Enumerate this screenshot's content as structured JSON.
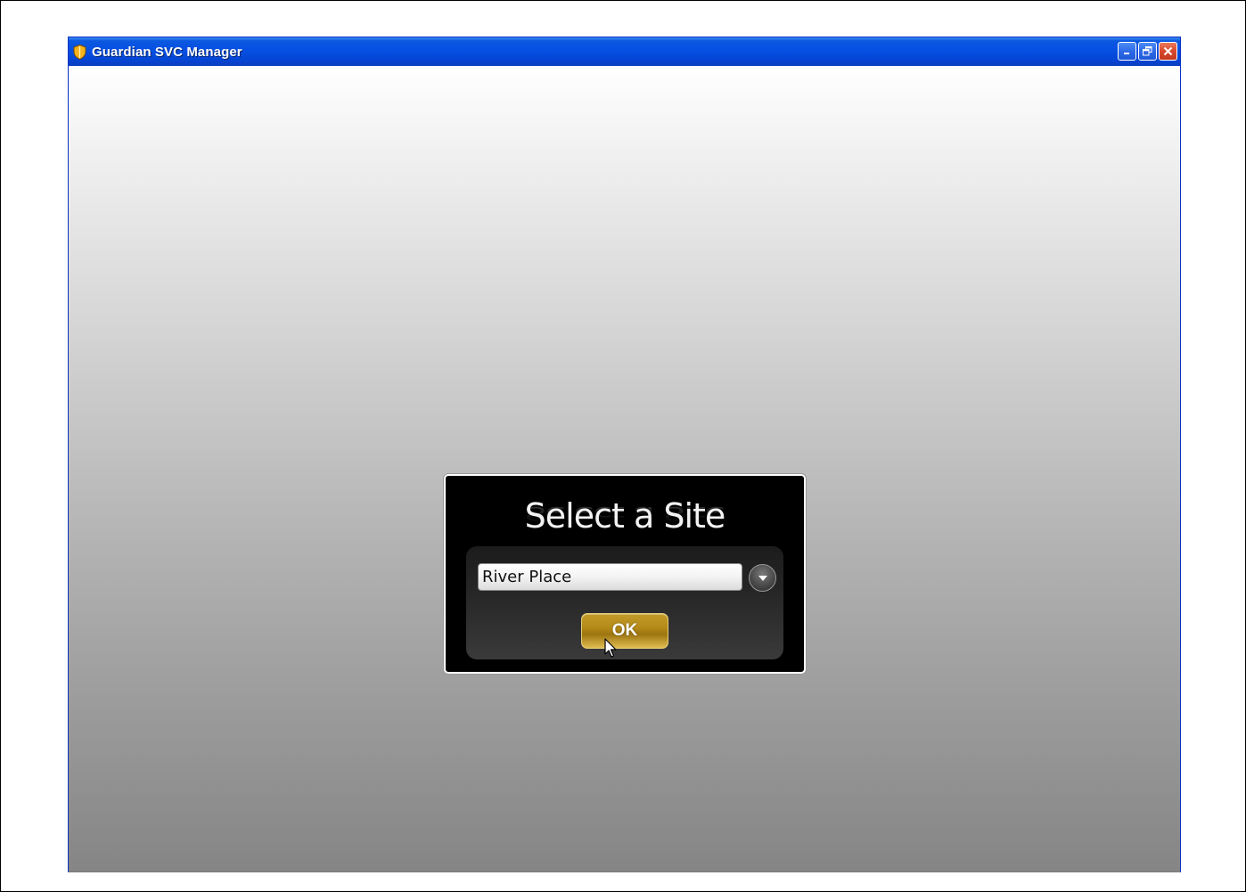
{
  "window": {
    "title": "Guardian SVC Manager",
    "app_icon": "shield-icon",
    "controls": [
      "minimize-icon",
      "restore-icon",
      "close-icon"
    ],
    "titlebar_color": "#0650e2"
  },
  "dialog": {
    "title": "Select a Site",
    "site_select": {
      "value": "River Place",
      "dropdown_icon": "chevron-down-icon"
    },
    "ok_label": "OK",
    "ok_color": "#b58a18"
  }
}
